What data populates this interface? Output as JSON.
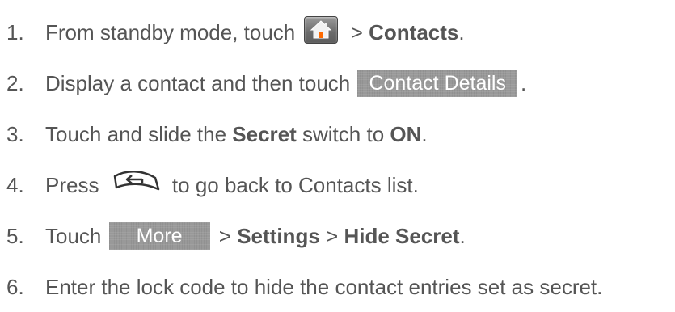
{
  "steps": [
    {
      "number": "1.",
      "text_before": "From standby mode, touch ",
      "icon": "home-key-icon",
      "text_middle": " > ",
      "bold": "Contacts",
      "text_after": "."
    },
    {
      "number": "2.",
      "text_before": "Display a contact and then touch ",
      "button": "Contact Details",
      "text_after": "."
    },
    {
      "number": "3.",
      "text_before": "Touch and slide the ",
      "bold1": "Secret",
      "text_middle": " switch to ",
      "bold2": "ON",
      "text_after": "."
    },
    {
      "number": "4.",
      "text_before": "Press ",
      "icon": "back-key-icon",
      "text_after": " to go back to Contacts list."
    },
    {
      "number": "5.",
      "text_before": "Touch ",
      "button": "More",
      "sep1": " > ",
      "bold1": "Settings",
      "sep2": " > ",
      "bold2": "Hide Secret",
      "text_after": "."
    },
    {
      "number": "6.",
      "text": "Enter the lock code to hide the contact entries set as secret."
    }
  ]
}
